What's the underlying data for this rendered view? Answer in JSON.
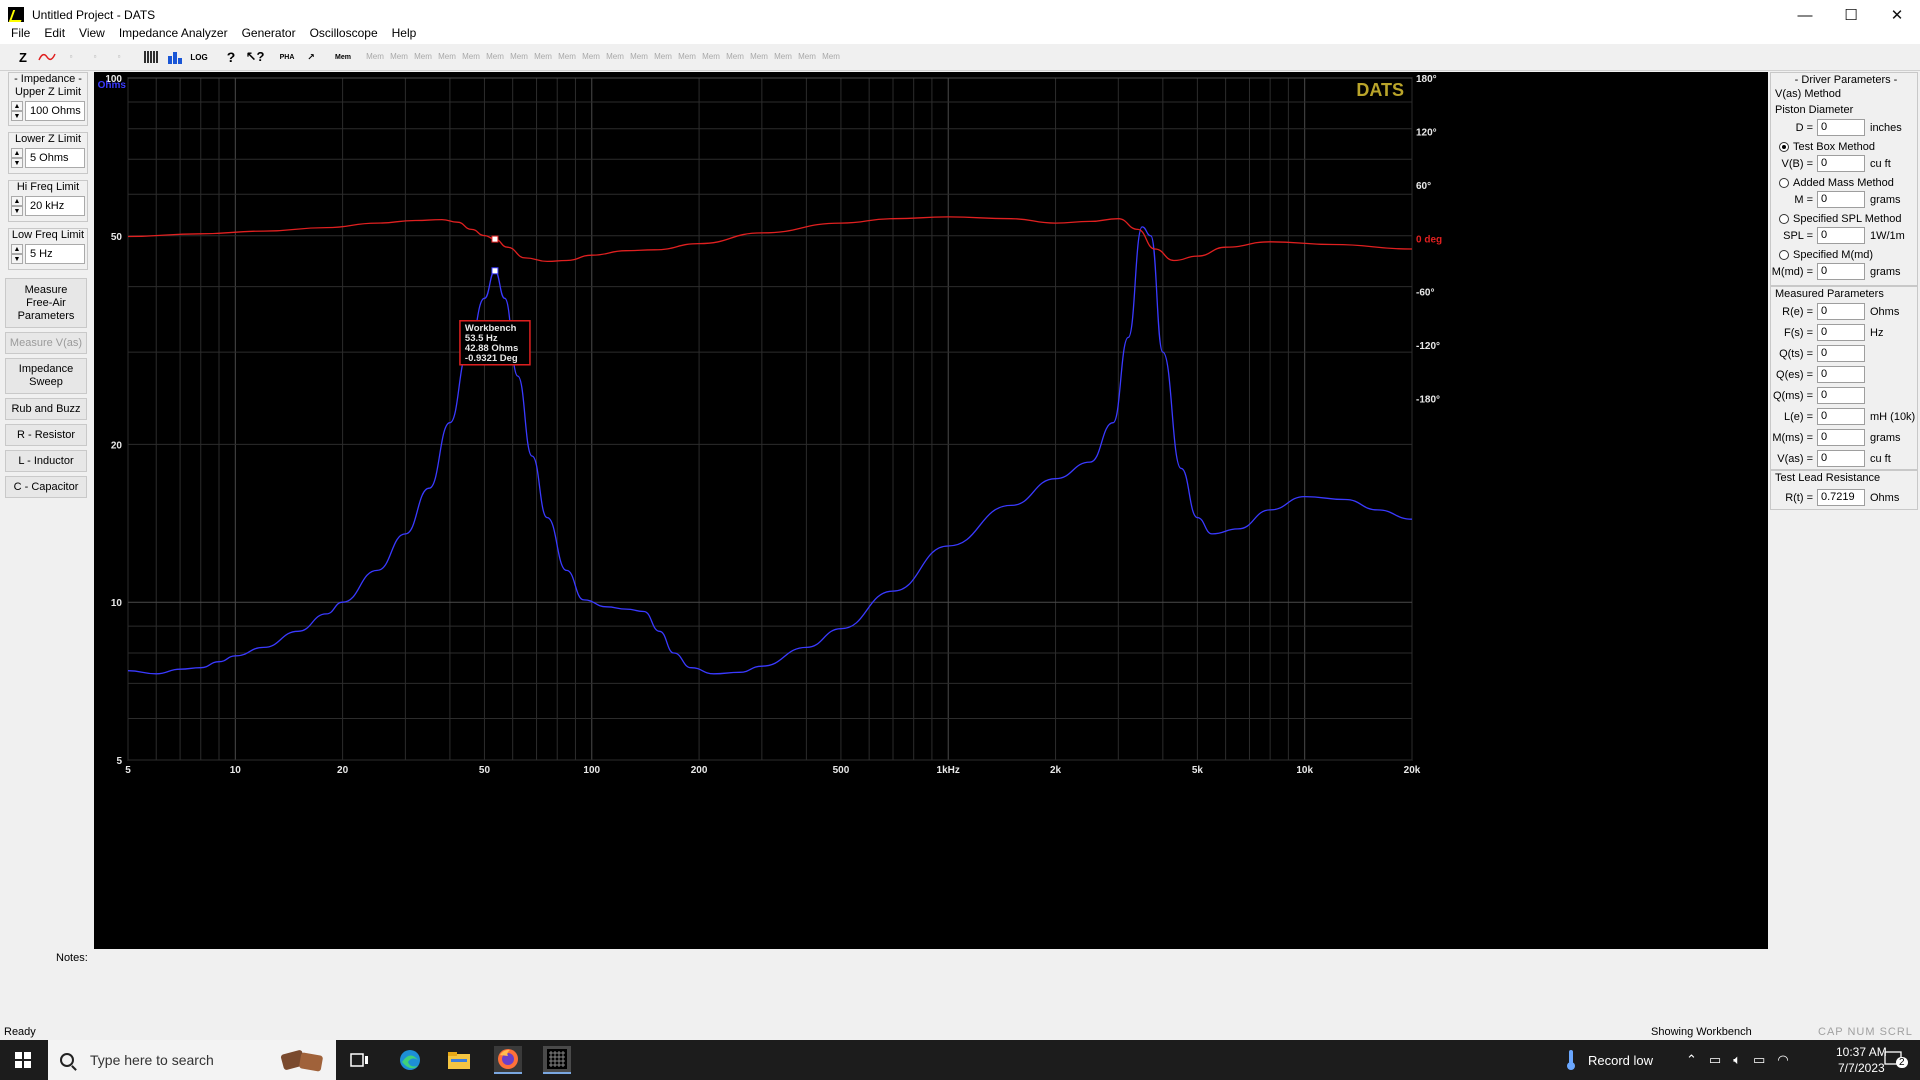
{
  "window": {
    "title": "Untitled Project - DATS",
    "controls": {
      "minimize": "—",
      "maximize": "☐",
      "close": "✕"
    }
  },
  "menu": [
    "File",
    "Edit",
    "View",
    "Impedance Analyzer",
    "Generator",
    "Oscilloscope",
    "Help"
  ],
  "toolbar": {
    "z_label": "Z",
    "log_label": "LOG",
    "pha_label": "PHA",
    "mem_label": "Mem",
    "mem_slots": [
      "Mem",
      "Mem",
      "Mem",
      "Mem",
      "Mem",
      "Mem",
      "Mem",
      "Mem",
      "Mem",
      "Mem",
      "Mem",
      "Mem",
      "Mem",
      "Mem",
      "Mem",
      "Mem",
      "Mem",
      "Mem",
      "Mem",
      "Mem"
    ]
  },
  "left_panel": {
    "impedance_title": "- Impedance -",
    "upper_z_label": "Upper Z Limit",
    "upper_z_value": "100 Ohms",
    "lower_z_label": "Lower Z Limit",
    "lower_z_value": "5 Ohms",
    "hi_freq_label": "Hi Freq Limit",
    "hi_freq_value": "20 kHz",
    "low_freq_label": "Low Freq Limit",
    "low_freq_value": "5 Hz",
    "buttons": {
      "measure_free_air": "Measure Free-Air Parameters",
      "measure_vas": "Measure V(as)",
      "impedance_sweep": "Impedance Sweep",
      "rub_buzz": "Rub and Buzz",
      "resistor": "R - Resistor",
      "inductor": "L - Inductor",
      "capacitor": "C - Capacitor"
    }
  },
  "right_panel": {
    "driver_title": "- Driver Parameters -",
    "vas_method": "V(as) Method",
    "piston_diameter": "Piston Diameter",
    "d": {
      "label": "D =",
      "value": "0",
      "unit": "inches"
    },
    "test_box_method": "Test Box Method",
    "vb": {
      "label": "V(B) =",
      "value": "0",
      "unit": "cu ft"
    },
    "added_mass_method": "Added Mass Method",
    "m": {
      "label": "M =",
      "value": "0",
      "unit": "grams"
    },
    "specified_spl_method": "Specified SPL Method",
    "spl": {
      "label": "SPL =",
      "value": "0",
      "unit": "1W/1m"
    },
    "specified_mmd": "Specified M(md)",
    "mmd": {
      "label": "M(md) =",
      "value": "0",
      "unit": "grams"
    },
    "measured_title": "Measured Parameters",
    "measured": [
      {
        "label": "R(e) =",
        "value": "0",
        "unit": "Ohms"
      },
      {
        "label": "F(s) =",
        "value": "0",
        "unit": "Hz"
      },
      {
        "label": "Q(ts) =",
        "value": "0",
        "unit": ""
      },
      {
        "label": "Q(es) =",
        "value": "0",
        "unit": ""
      },
      {
        "label": "Q(ms) =",
        "value": "0",
        "unit": ""
      },
      {
        "label": "L(e) =",
        "value": "0",
        "unit": "mH (10k)"
      },
      {
        "label": "M(ms) =",
        "value": "0",
        "unit": "grams"
      },
      {
        "label": "V(as) =",
        "value": "0",
        "unit": "cu ft"
      }
    ],
    "test_lead_title": "Test Lead Resistance",
    "rt": {
      "label": "R(t) =",
      "value": "0.7219",
      "unit": "Ohms"
    }
  },
  "chart_data": {
    "type": "line",
    "brand": "DATS",
    "ylabel": "Ohms",
    "x_scale": "log",
    "y_scale": "log",
    "xlim": [
      5,
      20000
    ],
    "ylim": [
      5,
      100
    ],
    "y2lim": [
      -180,
      180
    ],
    "x_ticks": [
      {
        "v": 5,
        "label": "5"
      },
      {
        "v": 10,
        "label": "10"
      },
      {
        "v": 20,
        "label": "20"
      },
      {
        "v": 50,
        "label": "50"
      },
      {
        "v": 100,
        "label": "100"
      },
      {
        "v": 200,
        "label": "200"
      },
      {
        "v": 500,
        "label": "500"
      },
      {
        "v": 1000,
        "label": "1kHz"
      },
      {
        "v": 2000,
        "label": "2k"
      },
      {
        "v": 5000,
        "label": "5k"
      },
      {
        "v": 10000,
        "label": "10k"
      },
      {
        "v": 20000,
        "label": "20k"
      }
    ],
    "y_ticks": [
      {
        "v": 100,
        "label": "100"
      },
      {
        "v": 50,
        "label": "50"
      },
      {
        "v": 20,
        "label": "20"
      },
      {
        "v": 10,
        "label": "10"
      },
      {
        "v": 5,
        "label": "5"
      }
    ],
    "y2_ticks": [
      {
        "v": 180,
        "label": "180°"
      },
      {
        "v": 120,
        "label": "120°"
      },
      {
        "v": 60,
        "label": "60°"
      },
      {
        "v": 0,
        "label": "0 deg"
      },
      {
        "v": -60,
        "label": "-60°"
      },
      {
        "v": -120,
        "label": "-120°"
      },
      {
        "v": -180,
        "label": "-180°"
      }
    ],
    "grid": true,
    "series": [
      {
        "color": "#3a3aff",
        "axis": "left",
        "points": [
          [
            5,
            7.4
          ],
          [
            6,
            7.3
          ],
          [
            7,
            7.45
          ],
          [
            8,
            7.5
          ],
          [
            9,
            7.7
          ],
          [
            10,
            7.9
          ],
          [
            12,
            8.2
          ],
          [
            15,
            8.8
          ],
          [
            18,
            9.5
          ],
          [
            20,
            10.0
          ],
          [
            25,
            11.5
          ],
          [
            30,
            13.5
          ],
          [
            35,
            16.5
          ],
          [
            40,
            22
          ],
          [
            45,
            30
          ],
          [
            50,
            38
          ],
          [
            53.5,
            42.88
          ],
          [
            57,
            38
          ],
          [
            62,
            27
          ],
          [
            68,
            19
          ],
          [
            75,
            14.5
          ],
          [
            85,
            11.5
          ],
          [
            95,
            10.1
          ],
          [
            110,
            9.8
          ],
          [
            125,
            9.7
          ],
          [
            140,
            9.6
          ],
          [
            155,
            8.8
          ],
          [
            170,
            8.0
          ],
          [
            190,
            7.5
          ],
          [
            220,
            7.3
          ],
          [
            260,
            7.35
          ],
          [
            300,
            7.55
          ],
          [
            400,
            8.2
          ],
          [
            500,
            8.9
          ],
          [
            700,
            10.5
          ],
          [
            1000,
            12.8
          ],
          [
            1500,
            15.3
          ],
          [
            2000,
            17.2
          ],
          [
            2500,
            18.5
          ],
          [
            2900,
            22
          ],
          [
            3200,
            32
          ],
          [
            3500,
            52
          ],
          [
            3700,
            50
          ],
          [
            4000,
            30
          ],
          [
            4500,
            18
          ],
          [
            5000,
            14.5
          ],
          [
            5500,
            13.5
          ],
          [
            6500,
            13.8
          ],
          [
            8000,
            15.0
          ],
          [
            10000,
            15.9
          ],
          [
            13000,
            15.7
          ],
          [
            16000,
            15.0
          ],
          [
            20000,
            14.4
          ]
        ]
      },
      {
        "color": "#e02020",
        "axis": "right",
        "points": [
          [
            5,
            2
          ],
          [
            8,
            5
          ],
          [
            12,
            8
          ],
          [
            18,
            12
          ],
          [
            25,
            17
          ],
          [
            32,
            20
          ],
          [
            38,
            21
          ],
          [
            42,
            18
          ],
          [
            46,
            10
          ],
          [
            50,
            3
          ],
          [
            53.5,
            -0.9321
          ],
          [
            58,
            -10
          ],
          [
            65,
            -22
          ],
          [
            75,
            -26
          ],
          [
            85,
            -25
          ],
          [
            100,
            -19
          ],
          [
            125,
            -14
          ],
          [
            150,
            -13
          ],
          [
            200,
            -6
          ],
          [
            300,
            6
          ],
          [
            500,
            17
          ],
          [
            700,
            22
          ],
          [
            1000,
            24
          ],
          [
            1500,
            22
          ],
          [
            2000,
            17
          ],
          [
            2500,
            19
          ],
          [
            3000,
            22
          ],
          [
            3400,
            10
          ],
          [
            3800,
            -12
          ],
          [
            4300,
            -25
          ],
          [
            5000,
            -20
          ],
          [
            6000,
            -10
          ],
          [
            8000,
            -4
          ],
          [
            12000,
            -7
          ],
          [
            20000,
            -12
          ]
        ]
      }
    ],
    "marker": {
      "series_name": "Workbench",
      "freq_label": "53.5 Hz",
      "ohms_label": "42.88 Ohms",
      "deg_label": "-0.9321 Deg",
      "freq": 53.5,
      "ohms": 42.88,
      "deg": -0.9321
    }
  },
  "notes": {
    "label": "Notes:"
  },
  "status": {
    "left": "Ready",
    "showing": "Showing Workbench",
    "keys": "CAP NUM SCRL"
  },
  "taskbar": {
    "search_placeholder": "Type here to search",
    "weather": "Record low",
    "time": "10:37 AM",
    "date": "7/7/2023",
    "notification_count": "2"
  },
  "colors": {
    "plot_bg": "#000000",
    "grid": "#3a3a3a",
    "impedance": "#3a3aff",
    "phase": "#e02020",
    "brand": "#b9a42a"
  }
}
